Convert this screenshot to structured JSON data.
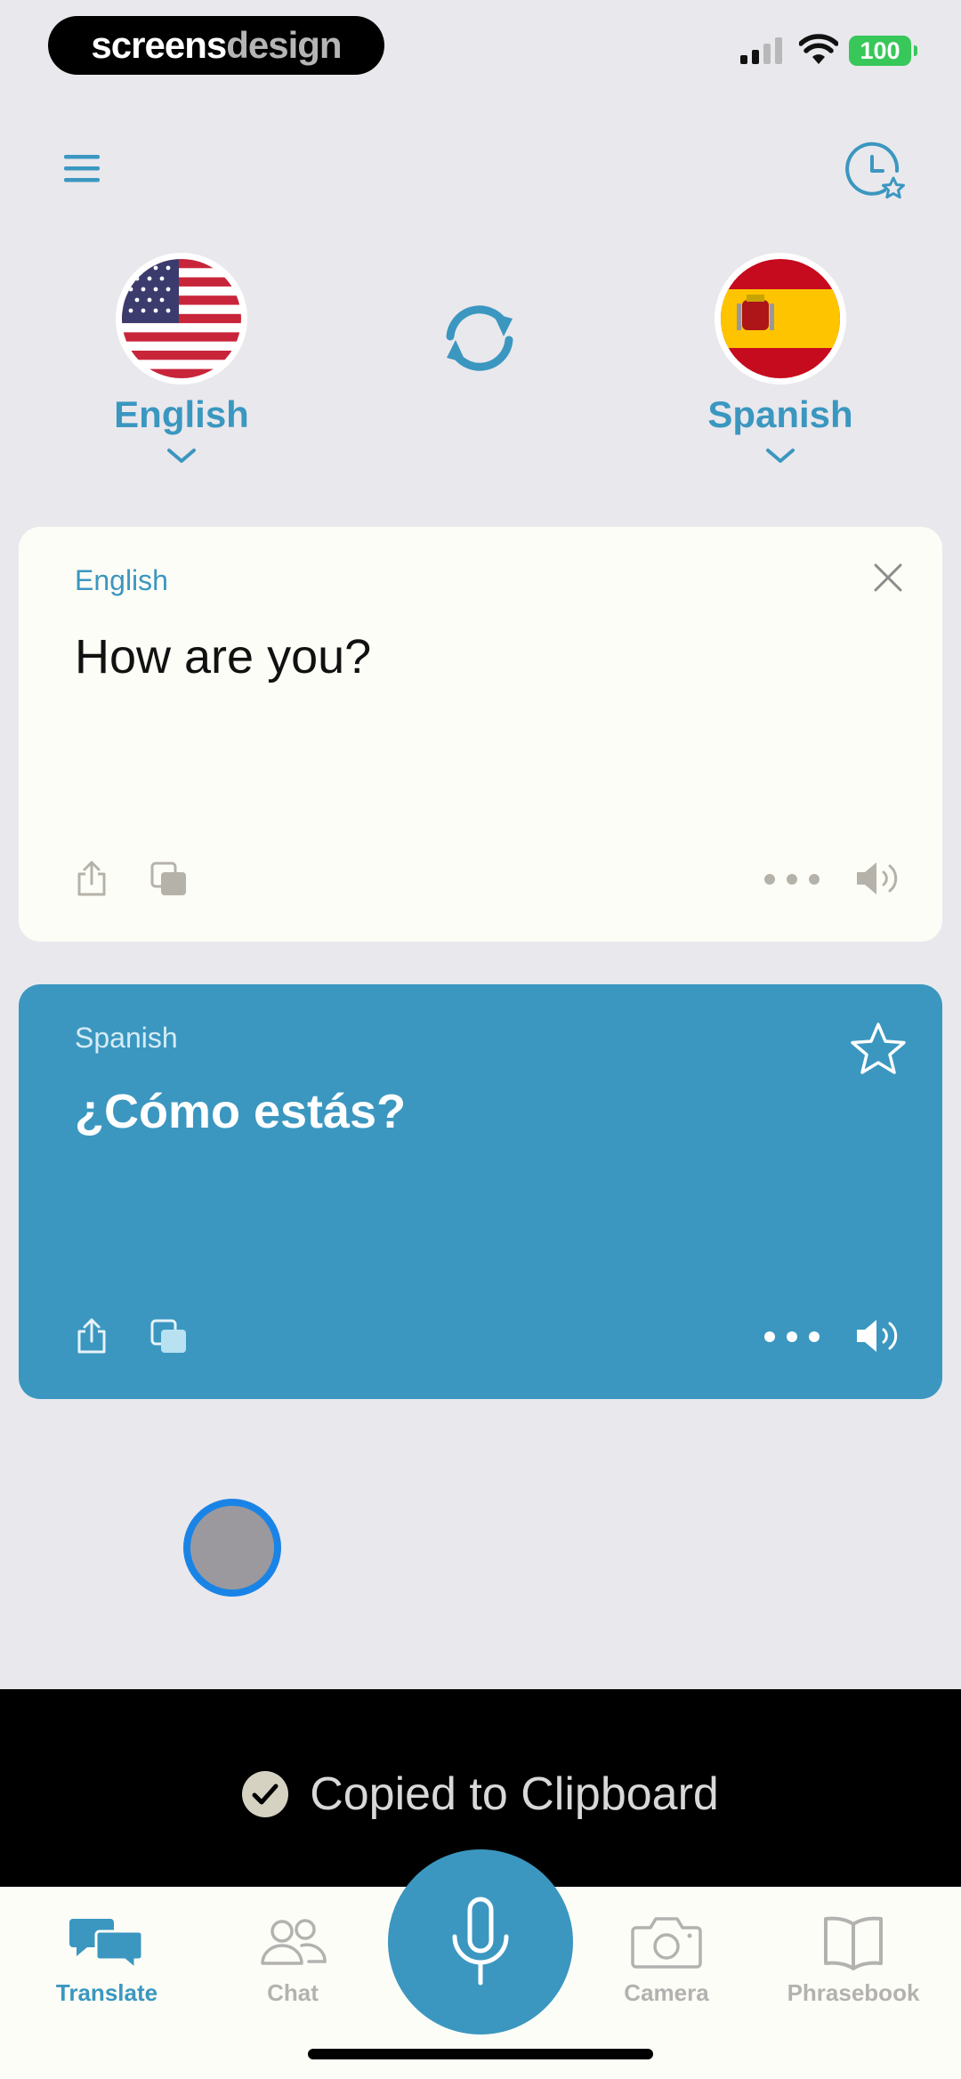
{
  "status_bar": {
    "brand_part1": "screens",
    "brand_part2": "design",
    "battery": "100"
  },
  "languages": {
    "source": "English",
    "target": "Spanish"
  },
  "source_card": {
    "language": "English",
    "text": "How are you?"
  },
  "target_card": {
    "language": "Spanish",
    "text": "¿Cómo estás?"
  },
  "toast": {
    "message": "Copied to Clipboard"
  },
  "tabs": {
    "translate": "Translate",
    "chat": "Chat",
    "camera": "Camera",
    "phrasebook": "Phrasebook"
  },
  "colors": {
    "accent": "#3b97c0",
    "background": "#e9e8ed",
    "card_light": "#fdfdf7",
    "battery": "#38c759"
  }
}
